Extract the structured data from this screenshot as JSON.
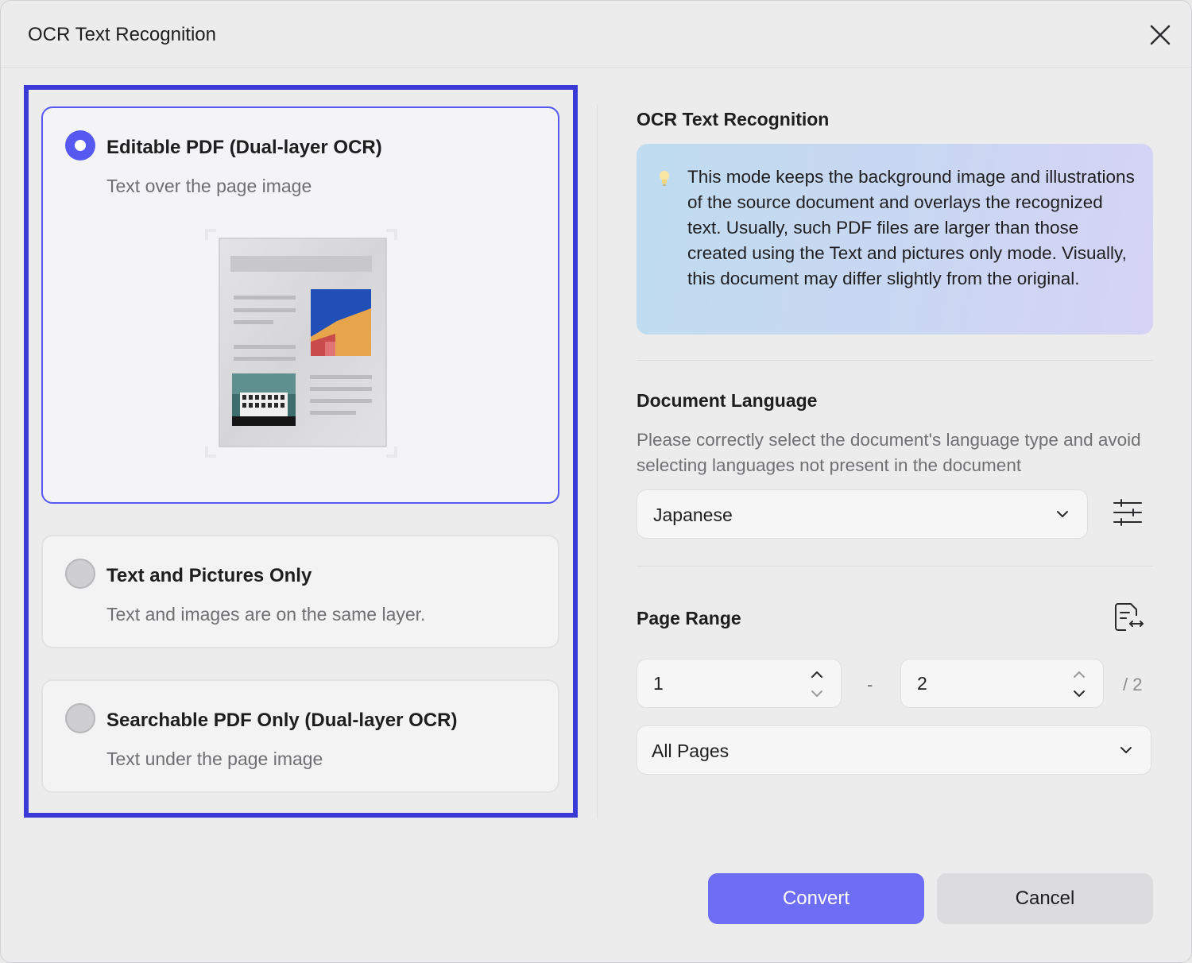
{
  "dialog": {
    "title": "OCR Text Recognition"
  },
  "modes": [
    {
      "title": "Editable PDF (Dual-layer OCR)",
      "description": "Text over the page image",
      "selected": true
    },
    {
      "title": "Text and Pictures Only",
      "description": "Text and images are on the same layer.",
      "selected": false
    },
    {
      "title": "Searchable PDF Only (Dual-layer OCR)",
      "description": "Text under the page image",
      "selected": false
    }
  ],
  "ocr_section": {
    "heading": "OCR Text Recognition",
    "info_icon": "lightbulb-icon",
    "info_text": "This mode keeps the background image and illustrations of the source document and overlays the recognized text. Usually, such PDF files are larger than those created using the Text and pictures only mode. Visually, this document may differ slightly from the original."
  },
  "language_section": {
    "heading": "Document Language",
    "hint": "Please correctly select the document's language type and avoid selecting languages not present in the document",
    "selected_language": "Japanese",
    "settings_icon": "sliders-icon"
  },
  "page_range": {
    "heading": "Page Range",
    "from": "1",
    "separator": "-",
    "to": "2",
    "total": "/ 2",
    "range_option": "All Pages",
    "icon": "page-swap-icon"
  },
  "buttons": {
    "convert": "Convert",
    "cancel": "Cancel"
  },
  "colors": {
    "accent": "#5559f2",
    "highlight_border": "#3a3ad6",
    "primary_button": "#6d6df5"
  }
}
